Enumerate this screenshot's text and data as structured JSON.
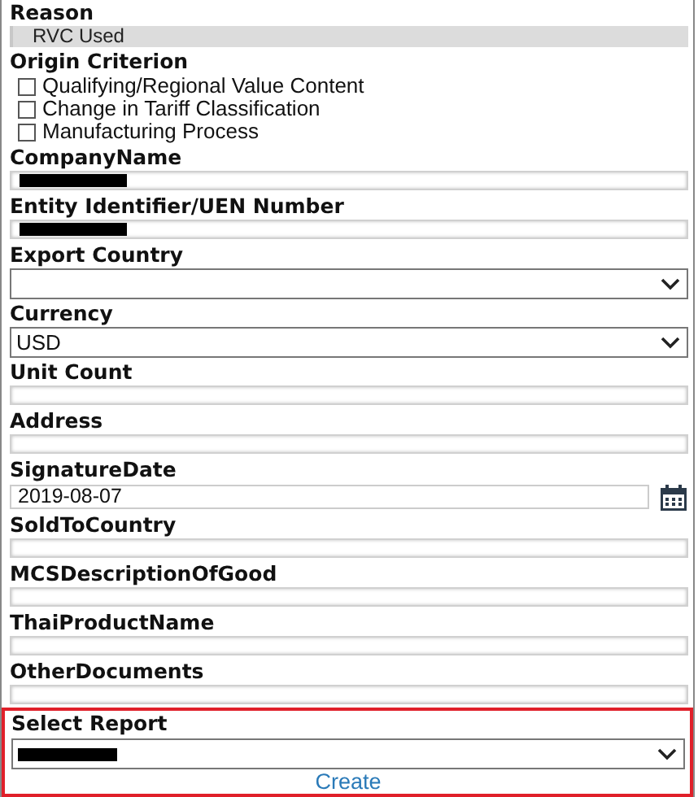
{
  "fields": [
    {
      "kind": "readonly",
      "label": "Reason",
      "value": "RVC Used"
    },
    {
      "kind": "checkboxes",
      "label": "Origin Criterion",
      "options": [
        {
          "label": "Qualifying/Regional Value Content",
          "checked": false
        },
        {
          "label": "Change in Tariff Classification",
          "checked": false
        },
        {
          "label": "Manufacturing Process",
          "checked": false
        }
      ]
    },
    {
      "kind": "text",
      "label": "CompanyName",
      "redacted": true
    },
    {
      "kind": "text",
      "label": "Entity Identifier/UEN Number",
      "redacted": true
    },
    {
      "kind": "select",
      "label": "Export Country"
    },
    {
      "kind": "select",
      "label": "Currency",
      "value": "USD"
    },
    {
      "kind": "text",
      "label": "Unit Count"
    },
    {
      "kind": "text",
      "label": "Address"
    },
    {
      "kind": "date",
      "label": "SignatureDate",
      "value": "2019-08-07"
    },
    {
      "kind": "text",
      "label": "SoldToCountry"
    },
    {
      "kind": "text",
      "label": "MCSDescriptionOfGood"
    },
    {
      "kind": "text",
      "label": "ThaiProductName"
    },
    {
      "kind": "text",
      "label": "OtherDocuments"
    }
  ],
  "report": {
    "highlighted": true,
    "label": "Select Report",
    "redacted": true,
    "link": "Create"
  }
}
